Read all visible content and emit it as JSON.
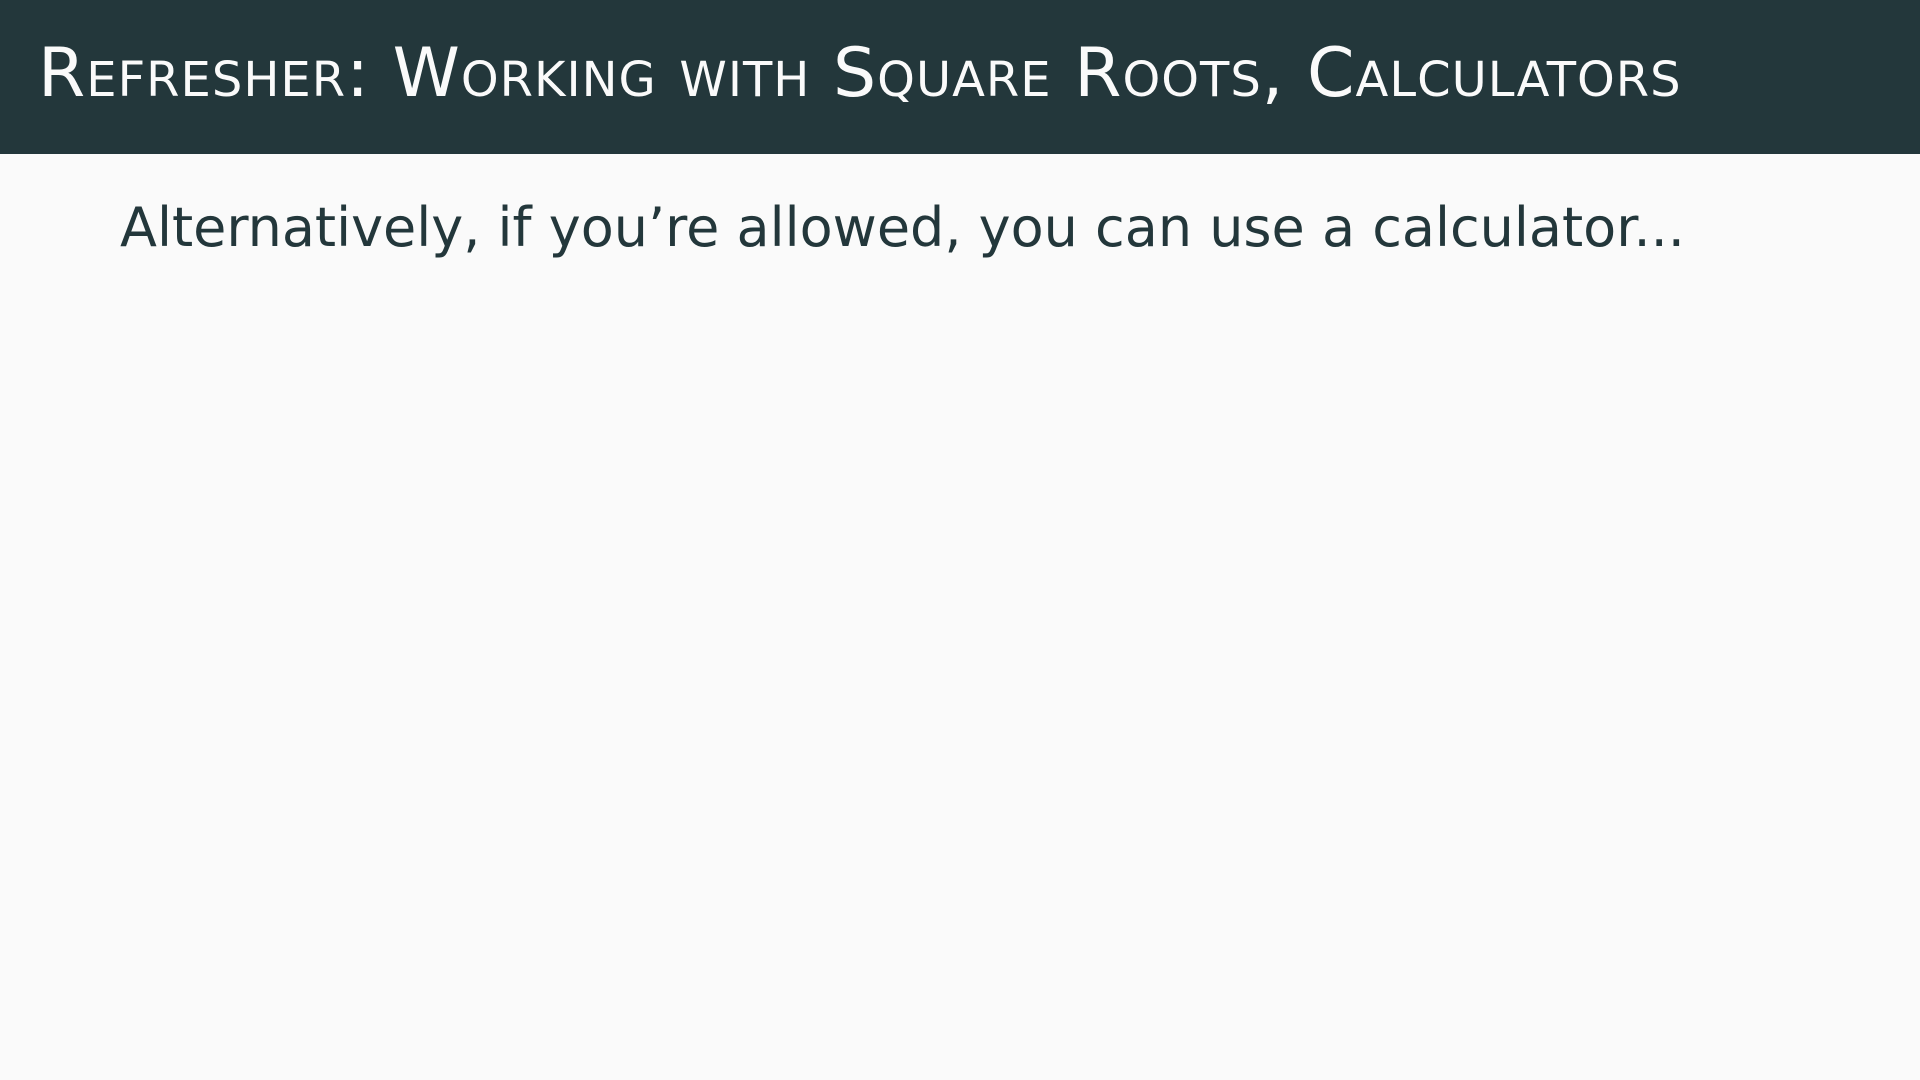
{
  "slide": {
    "title": "Refresher: Working with Square Roots, Calculators",
    "body_text": "Alternatively, if you’re allowed, you can use a calculator...",
    "colors": {
      "title_bar_background": "#23373b",
      "title_text": "#fafafa",
      "body_background": "#fafafa",
      "body_text": "#23373b"
    }
  }
}
